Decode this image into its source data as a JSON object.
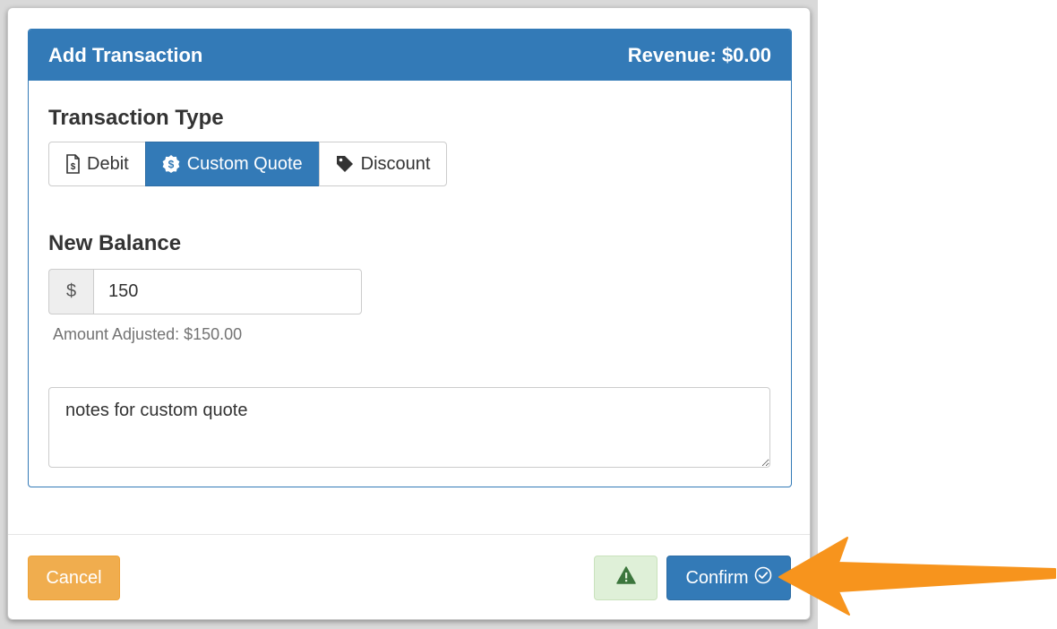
{
  "panel": {
    "title": "Add Transaction",
    "revenue": "Revenue: $0.00"
  },
  "transaction_type": {
    "heading": "Transaction Type",
    "options": [
      {
        "label": "Debit",
        "icon": "receipt-icon",
        "active": false
      },
      {
        "label": "Custom Quote",
        "icon": "dollar-badge-icon",
        "active": true
      },
      {
        "label": "Discount",
        "icon": "tag-icon",
        "active": false
      }
    ]
  },
  "balance": {
    "heading": "New Balance",
    "currency_symbol": "$",
    "value": "150",
    "help": "Amount Adjusted: $150.00"
  },
  "notes": {
    "value": "notes for custom quote"
  },
  "footer": {
    "cancel_label": "Cancel",
    "warning_icon": "warning-icon",
    "confirm_label": "Confirm",
    "confirm_icon": "check-circle-icon"
  },
  "colors": {
    "primary": "#337ab7",
    "warning": "#f0ad4e",
    "success_bg": "#dff0d8",
    "success_icon": "#3c763d",
    "annotation_arrow": "#f7941d"
  }
}
